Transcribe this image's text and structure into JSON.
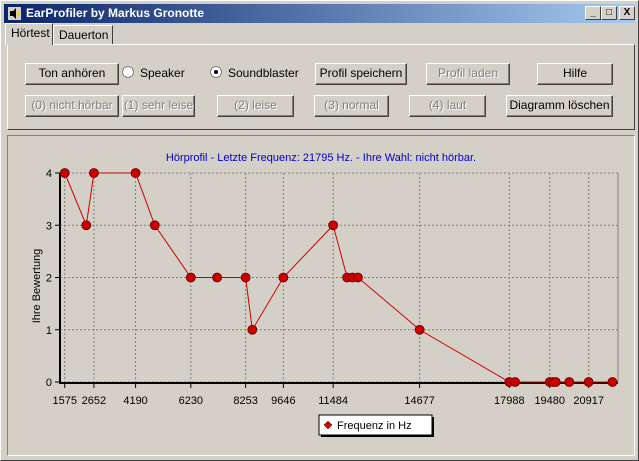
{
  "window": {
    "title": "EarProfiler by Markus Gronotte",
    "min_label": "_",
    "max_label": "□",
    "close_label": "X"
  },
  "tabs": [
    {
      "label": "Hörtest"
    },
    {
      "label": "Dauerton"
    }
  ],
  "controls": {
    "play_button": "Ton anhören",
    "radio_speaker": "Speaker",
    "radio_soundblaster": "Soundblaster",
    "selected_output": "Soundblaster",
    "save_profile": "Profil speichern",
    "load_profile": "Profil laden",
    "help": "Hilfe",
    "rating0": "(0) nicht hörbar",
    "rating1": "(1) sehr leise",
    "rating2": "(2) leise",
    "rating3": "(3) normal",
    "rating4": "(4) laut",
    "clear_chart": "Diagramm löschen"
  },
  "chart_data": {
    "type": "line",
    "title": "Hörprofil - Letzte Frequenz: 21795 Hz. - Ihre Wahl: nicht hörbar.",
    "xlabel": "",
    "ylabel": "Ihre Bewertung",
    "xlim": [
      1400,
      22000
    ],
    "ylim": [
      0,
      4
    ],
    "xticks": [
      1575,
      2652,
      4190,
      6230,
      8253,
      9646,
      11484,
      14677,
      17988,
      19480,
      20917
    ],
    "yticks": [
      0,
      1,
      2,
      3,
      4
    ],
    "grid": true,
    "legend": "bottom-center",
    "series": [
      {
        "name": "Frequenz in Hz",
        "color": "#cc0000",
        "x": [
          1575,
          2370,
          2652,
          4190,
          4900,
          6230,
          7200,
          8253,
          8500,
          9646,
          11484,
          12000,
          12200,
          12400,
          14677,
          17988,
          18200,
          19480,
          19600,
          19700,
          20200,
          20917,
          21795
        ],
        "y": [
          4,
          3,
          4,
          4,
          3,
          2,
          2,
          2,
          1,
          2,
          3,
          2,
          2,
          2,
          1,
          0,
          0,
          0,
          0,
          0,
          0,
          0,
          0
        ]
      }
    ]
  }
}
